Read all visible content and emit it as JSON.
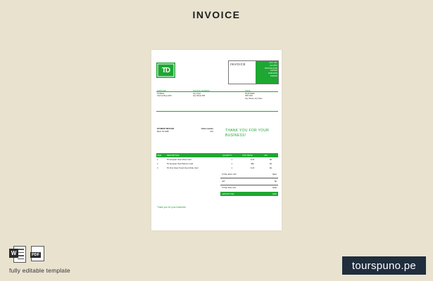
{
  "header": {
    "title": "INVOICE"
  },
  "invoice": {
    "logo_text": "TD",
    "box_label": "INVOICE",
    "box_lines": [
      "ACC. NO.",
      "123 4567",
      "INVOICE DATE",
      "01/04/20",
      "DUE DATE",
      "01/04/20"
    ],
    "bill_to": {
      "label": "SUPPLIER",
      "lines": [
        "TD Bank",
        "Card ending 1234"
      ]
    },
    "ship_to": {
      "label": "INVOICE ADDRESS",
      "lines": [
        "Any Town",
        "Any Street 000"
      ]
    },
    "details": {
      "label": "ISSUE",
      "lines": [
        "00-00-0000",
        "456 1234",
        "Any Street, Any Town"
      ]
    },
    "payment": {
      "method_label": "PAYMENT METHOD",
      "method_value": "Bank TD 4288",
      "order_label": "Order number",
      "order_value": "001"
    },
    "thank_you": "THANK YOU FOR YOUR BUSINESS!",
    "table": {
      "headers": [
        "ITEM",
        "DESCRIPTION",
        "QUANTITY",
        "UNIT PRICE",
        "VAT"
      ],
      "rows": [
        [
          "1",
          "TD Aeroplan Visa Infinite Card",
          "1",
          "$ 30",
          "$0"
        ],
        [
          "2",
          "TD Aeroplan Visa Platinum Card",
          "1",
          "$60",
          "$0"
        ],
        [
          "3",
          "TD First Class Travel Visa Infinite Card",
          "1",
          "$ 20",
          "$0"
        ]
      ]
    },
    "totals": [
      {
        "label": "TOTAL EXCL VAT",
        "value": "$210"
      },
      {
        "label": "VAT",
        "value": "$0"
      },
      {
        "label": "TOTAL INCL VAT",
        "value": "$160"
      }
    ],
    "amount_due": {
      "label": "AMOUNT DUE",
      "value": "$160"
    },
    "footer_note": "Thank you for your business!"
  },
  "bottom": {
    "word_icon": "word-icon",
    "pdf_icon": "pdf-icon",
    "word_letter": "W",
    "pdf_label": "PDF",
    "editable": "fully editable template",
    "brand": "tourspuno.pe"
  },
  "colors": {
    "accent": "#1ea733",
    "background": "#e8e2cf",
    "brand_bg": "#1f2d3d"
  }
}
